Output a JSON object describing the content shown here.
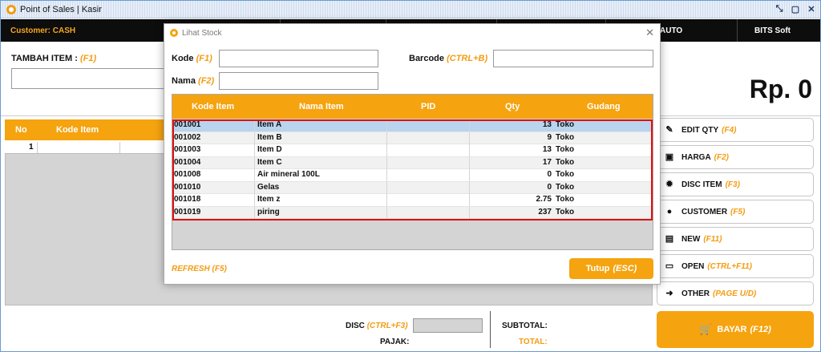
{
  "window": {
    "title": "Point of Sales | Kasir"
  },
  "header": {
    "customer": "Customer: CASH",
    "auto": "AUTO",
    "brand": "BITS Soft"
  },
  "tambah": {
    "label": "TAMBAH ITEM :",
    "shortcut": "(F1)"
  },
  "total_display": "Rp. 0",
  "grid": {
    "columns": [
      "No",
      "Kode Item"
    ],
    "rows": [
      {
        "no": "1"
      }
    ]
  },
  "side_buttons": [
    {
      "label": "EDIT QTY",
      "shortcut": "(F4)",
      "icon": "edit-icon"
    },
    {
      "label": "HARGA",
      "shortcut": "(F2)",
      "icon": "money-icon"
    },
    {
      "label": "DISC ITEM",
      "shortcut": "(F3)",
      "icon": "discount-icon"
    },
    {
      "label": "CUSTOMER",
      "shortcut": "(F5)",
      "icon": "person-icon"
    },
    {
      "label": "NEW",
      "shortcut": "(F11)",
      "icon": "document-icon"
    },
    {
      "label": "OPEN",
      "shortcut": "(CTRL+F11)",
      "icon": "folder-icon"
    },
    {
      "label": "OTHER",
      "shortcut": "(PAGE U/D)",
      "icon": "arrow-right-icon"
    }
  ],
  "bayar": {
    "label": "BAYAR",
    "shortcut": "(F12)",
    "icon": "cart-icon"
  },
  "bottom": {
    "disc_label": "DISC",
    "disc_shortcut": "(CTRL+F3)",
    "pajak_label": "PAJAK:",
    "subtotal_label": "SUBTOTAL:",
    "total_label": "TOTAL:"
  },
  "modal": {
    "title": "Lihat Stock",
    "kode_label": "Kode",
    "kode_shortcut": "(F1)",
    "nama_label": "Nama",
    "nama_shortcut": "(F2)",
    "barcode_label": "Barcode",
    "barcode_shortcut": "(CTRL+B)",
    "columns": [
      "Kode Item",
      "Nama Item",
      "PID",
      "Qty",
      "Gudang"
    ],
    "rows": [
      {
        "kode": "001001",
        "nama": "Item A",
        "pid": "",
        "qty": "13",
        "gudang": "Toko"
      },
      {
        "kode": "001002",
        "nama": "Item B",
        "pid": "",
        "qty": "9",
        "gudang": "Toko"
      },
      {
        "kode": "001003",
        "nama": "Item D",
        "pid": "",
        "qty": "13",
        "gudang": "Toko"
      },
      {
        "kode": "001004",
        "nama": "Item C",
        "pid": "",
        "qty": "17",
        "gudang": "Toko"
      },
      {
        "kode": "001008",
        "nama": "Air mineral 100L",
        "pid": "",
        "qty": "0",
        "gudang": "Toko"
      },
      {
        "kode": "001010",
        "nama": "Gelas",
        "pid": "",
        "qty": "0",
        "gudang": "Toko"
      },
      {
        "kode": "001018",
        "nama": "Item z",
        "pid": "",
        "qty": "2.75",
        "gudang": "Toko"
      },
      {
        "kode": "001019",
        "nama": "piring",
        "pid": "",
        "qty": "237",
        "gudang": "Toko"
      }
    ],
    "refresh_label": "REFRESH (F5)",
    "close_button": {
      "label": "Tutup",
      "shortcut": "(ESC)"
    }
  }
}
